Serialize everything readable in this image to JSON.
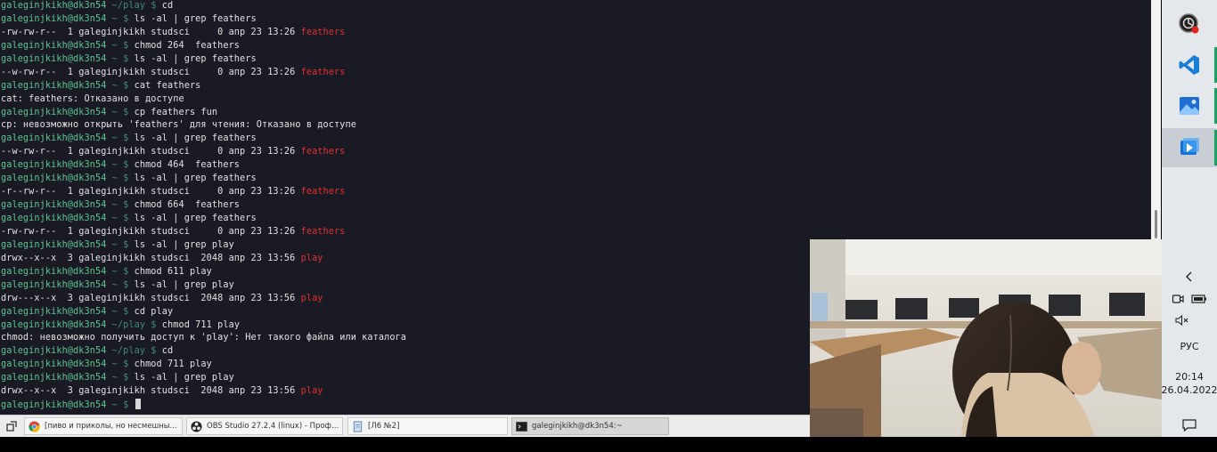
{
  "terminal": {
    "lines": [
      {
        "user": "galeginjkikh@dk3n54",
        "path": "~/play",
        "cmd": "cd"
      },
      {
        "user": "galeginjkikh@dk3n54",
        "path": "~",
        "cmd": "ls -al | grep feathers"
      },
      {
        "out": "-rw-rw-r--  1 galeginjkikh studsci     0 апр 23 13:26 ",
        "dir": "feathers"
      },
      {
        "user": "galeginjkikh@dk3n54",
        "path": "~",
        "cmd": "chmod 264  feathers"
      },
      {
        "user": "galeginjkikh@dk3n54",
        "path": "~",
        "cmd": "ls -al | grep feathers"
      },
      {
        "out": "--w-rw-r--  1 galeginjkikh studsci     0 апр 23 13:26 ",
        "dir": "feathers"
      },
      {
        "user": "galeginjkikh@dk3n54",
        "path": "~",
        "cmd": "cat feathers"
      },
      {
        "out": "cat: feathers: Отказано в доступе"
      },
      {
        "user": "galeginjkikh@dk3n54",
        "path": "~",
        "cmd": "cp feathers fun"
      },
      {
        "out": "cp: невозможно открыть 'feathers' для чтения: Отказано в доступе"
      },
      {
        "user": "galeginjkikh@dk3n54",
        "path": "~",
        "cmd": "ls -al | grep feathers"
      },
      {
        "out": "--w-rw-r--  1 galeginjkikh studsci     0 апр 23 13:26 ",
        "dir": "feathers"
      },
      {
        "user": "galeginjkikh@dk3n54",
        "path": "~",
        "cmd": "chmod 464  feathers"
      },
      {
        "user": "galeginjkikh@dk3n54",
        "path": "~",
        "cmd": "ls -al | grep feathers"
      },
      {
        "out": "-r--rw-r--  1 galeginjkikh studsci     0 апр 23 13:26 ",
        "dir": "feathers"
      },
      {
        "user": "galeginjkikh@dk3n54",
        "path": "~",
        "cmd": "chmod 664  feathers"
      },
      {
        "user": "galeginjkikh@dk3n54",
        "path": "~",
        "cmd": "ls -al | grep feathers"
      },
      {
        "out": "-rw-rw-r--  1 galeginjkikh studsci     0 апр 23 13:26 ",
        "dir": "feathers"
      },
      {
        "user": "galeginjkikh@dk3n54",
        "path": "~",
        "cmd": "ls -al | grep play"
      },
      {
        "out": "drwx--x--x  3 galeginjkikh studsci  2048 апр 23 13:56 ",
        "dir": "play"
      },
      {
        "user": "galeginjkikh@dk3n54",
        "path": "~",
        "cmd": "chmod 611 play"
      },
      {
        "user": "galeginjkikh@dk3n54",
        "path": "~",
        "cmd": "ls -al | grep play"
      },
      {
        "out": "drw---x--x  3 galeginjkikh studsci  2048 апр 23 13:56 ",
        "dir": "play"
      },
      {
        "user": "galeginjkikh@dk3n54",
        "path": "~",
        "cmd": "cd play"
      },
      {
        "user": "galeginjkikh@dk3n54",
        "path": "~/play",
        "cmd": "chmod 711 play"
      },
      {
        "out": "chmod: невозможно получить доступ к 'play': Нет такого файла или каталога"
      },
      {
        "user": "galeginjkikh@dk3n54",
        "path": "~/play",
        "cmd": "cd"
      },
      {
        "user": "galeginjkikh@dk3n54",
        "path": "~",
        "cmd": "chmod 711 play"
      },
      {
        "user": "galeginjkikh@dk3n54",
        "path": "~",
        "cmd": "ls -al | grep play"
      },
      {
        "out": "drwx--x--x  3 galeginjkikh studsci  2048 апр 23 13:56 ",
        "dir": "play"
      },
      {
        "user": "galeginjkikh@dk3n54",
        "path": "~",
        "cmd": "",
        "cursor": true
      }
    ]
  },
  "taskbar": {
    "tasks": [
      {
        "label": "[пиво и приколы, но несмешны...",
        "icon": "chrome-icon"
      },
      {
        "label": "OBS Studio 27.2.4 (linux) - Профи...",
        "icon": "obs-icon"
      },
      {
        "label": "[Л6 №2]",
        "icon": "document-icon"
      },
      {
        "label": "galeginjkikh@dk3n54:~",
        "icon": "terminal-icon"
      }
    ]
  },
  "winbar": {
    "language": "РУС",
    "time": "20:14",
    "date": "26.04.2022"
  },
  "colors": {
    "terminal_bg": "#1a1a24",
    "prompt_user": "#5bc494",
    "prompt_path": "#3f8c74",
    "dir_highlight": "#e03030"
  }
}
